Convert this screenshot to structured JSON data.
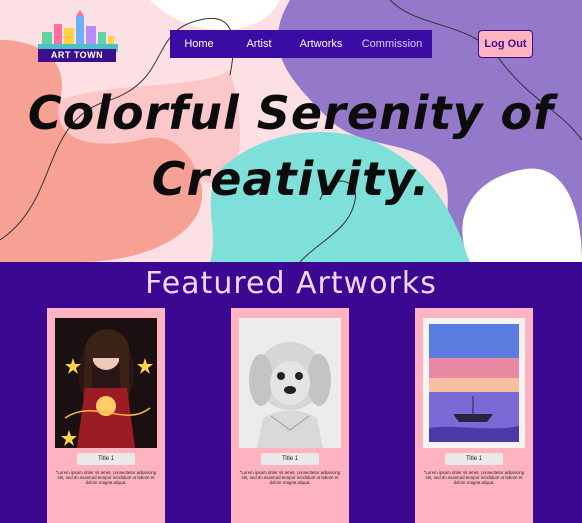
{
  "brand": {
    "logo_text": "ART TOWN"
  },
  "nav": {
    "items": [
      "Home",
      "Artist",
      "Artworks",
      "Commission"
    ],
    "active": "Commission"
  },
  "logout_label": "Log Out",
  "hero": {
    "title_line1": "Colorful Serenity of",
    "title_line2": "Creativity."
  },
  "featured": {
    "heading": "Featured Artworks",
    "cards": [
      {
        "title": "Title 1",
        "desc": "\"Lorem ipsum dolor sit amet, consectetur adipiscing elit, sed do eiusmod tempor incididunt ut labore et dolore magna aliqua."
      },
      {
        "title": "Title 1",
        "desc": "\"Lorem ipsum dolor sit amet, consectetur adipiscing elit, sed do eiusmod tempor incididunt ut labore et dolore magna aliqua."
      },
      {
        "title": "Title 1",
        "desc": "\"Lorem ipsum dolor sit amet, consectetur adipiscing elit, sed do eiusmod tempor incididunt ut labore et dolore magna aliqua."
      }
    ]
  },
  "colors": {
    "nav_bg": "#3a0ca3",
    "featured_bg": "#3b0891",
    "card_bg": "#ffb3c1",
    "blob_coral": "#f7a195",
    "blob_purple": "#9478c9",
    "blob_teal": "#7fe0d9"
  }
}
